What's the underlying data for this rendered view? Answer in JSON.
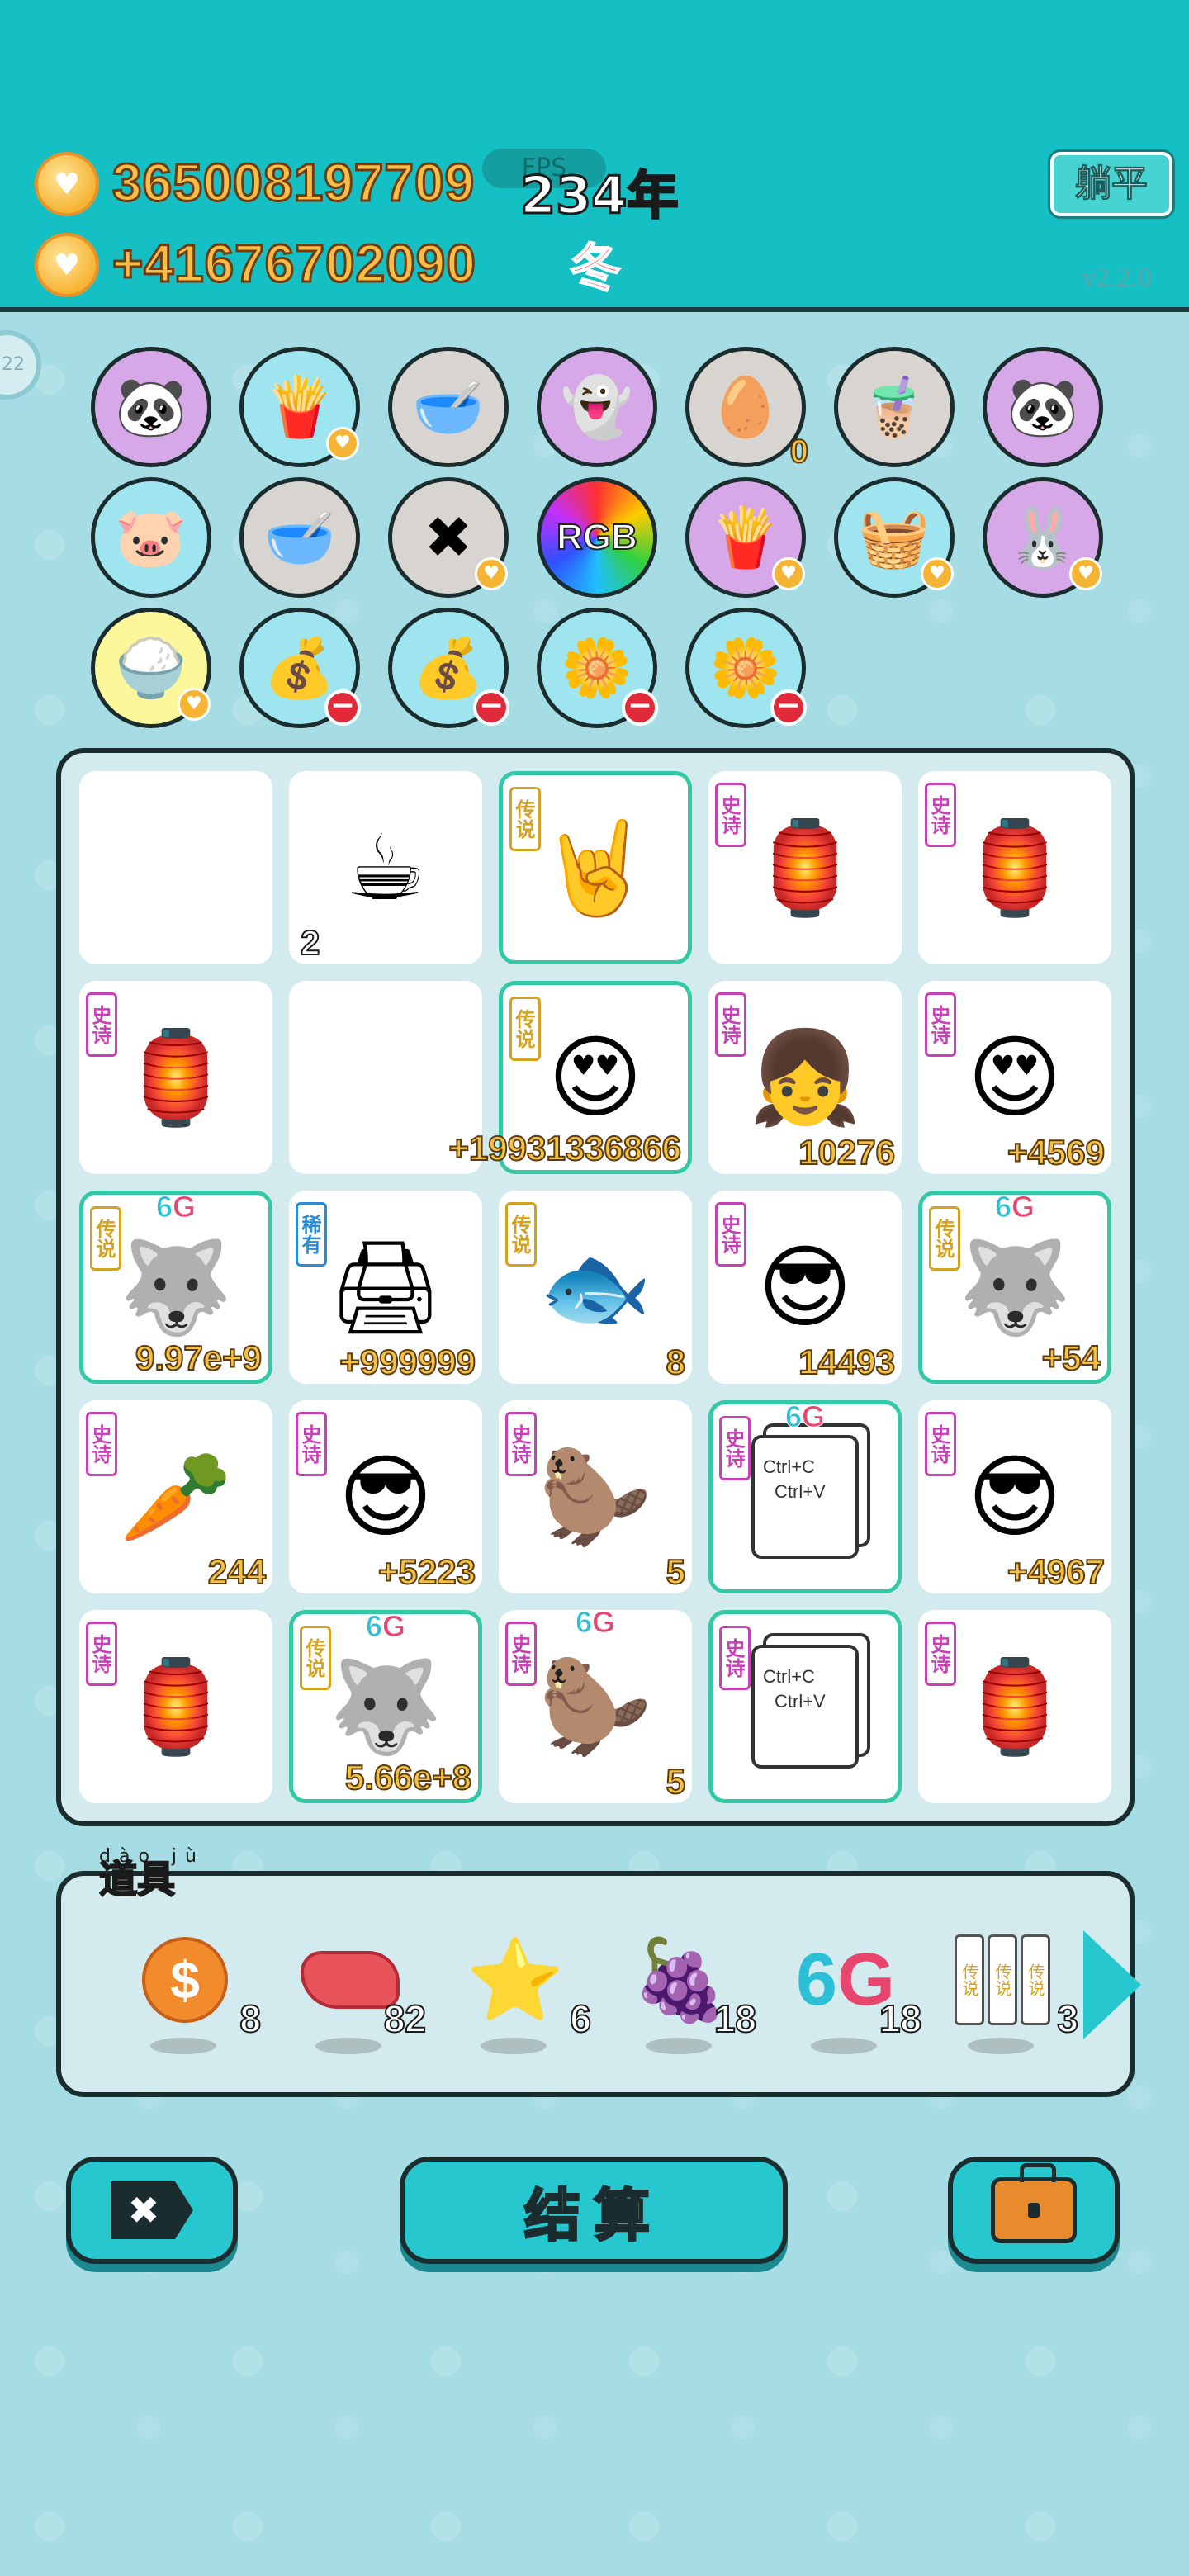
{
  "header": {
    "money": "365008197709",
    "income": "+41676702090",
    "fps_label": "FPS",
    "year": "234年",
    "season": "冬",
    "lieping_button": "躺平",
    "version": "v2.2.0",
    "side_bubble": "22"
  },
  "top_circles": [
    {
      "icon": "panda-icon",
      "glyph": "🐼",
      "color": "purple",
      "badge": ""
    },
    {
      "icon": "fries-icon",
      "glyph": "🍟",
      "color": "cyan",
      "badge": "heart"
    },
    {
      "icon": "pet-bowl-icon",
      "glyph": "🥣",
      "color": "grey",
      "badge": ""
    },
    {
      "icon": "ghost-icon",
      "glyph": "👻",
      "color": "purple",
      "badge": ""
    },
    {
      "icon": "egg-tray-icon",
      "glyph": "🥚",
      "color": "grey",
      "badge": "",
      "count": "0"
    },
    {
      "icon": "bubble-tea-icon",
      "glyph": "🧋",
      "color": "grey",
      "badge": ""
    },
    {
      "icon": "panda-icon",
      "glyph": "🐼",
      "color": "purple",
      "badge": ""
    },
    {
      "icon": "piggy-bank-icon",
      "glyph": "🐷",
      "color": "cyan",
      "badge": ""
    },
    {
      "icon": "pet-bowl-icon",
      "glyph": "🥣",
      "color": "grey",
      "badge": ""
    },
    {
      "icon": "delete-tag-icon",
      "glyph": "✖",
      "color": "grey",
      "badge": "heart"
    },
    {
      "icon": "rgb-icon",
      "glyph": "",
      "text": "RGB",
      "color": "rgb",
      "badge": ""
    },
    {
      "icon": "fries-icon",
      "glyph": "🍟",
      "color": "purple",
      "badge": "heart"
    },
    {
      "icon": "fruit-basket-icon",
      "glyph": "🧺",
      "color": "cyan",
      "badge": "heart"
    },
    {
      "icon": "rabbit-icon",
      "glyph": "🐰",
      "color": "purple",
      "badge": "heart"
    },
    {
      "icon": "rice-bowl-icon",
      "glyph": "🍚",
      "color": "yellow",
      "badge": "heart"
    },
    {
      "icon": "money-bag-icon",
      "glyph": "💰",
      "color": "cyan",
      "badge": "minus"
    },
    {
      "icon": "money-bag-icon",
      "glyph": "💰",
      "color": "cyan",
      "badge": "minus"
    },
    {
      "icon": "flower-pot-icon",
      "glyph": "🌼",
      "color": "cyan",
      "badge": "minus"
    },
    {
      "icon": "flower-pot-icon",
      "glyph": "🌼",
      "color": "cyan",
      "badge": "minus"
    }
  ],
  "board": [
    {
      "icon": "empty",
      "glyph": "",
      "tag": "",
      "count": "",
      "legend": false
    },
    {
      "icon": "coffee-cup-icon",
      "glyph": "☕",
      "tag": "",
      "count": "2",
      "count_style": "dark",
      "legend": false
    },
    {
      "icon": "rock-hand-icon",
      "glyph": "🤘",
      "tag": "传说",
      "tag_type": "leg",
      "count": "",
      "legend": true
    },
    {
      "icon": "rabbit-house-icon",
      "glyph": "🏮",
      "tag": "史诗",
      "tag_type": "epic",
      "count": "",
      "legend": false
    },
    {
      "icon": "rabbit-house-icon",
      "glyph": "🏮",
      "tag": "史诗",
      "tag_type": "epic",
      "count": "",
      "legend": false
    },
    {
      "icon": "rabbit-house-icon",
      "glyph": "🏮",
      "tag": "史诗",
      "tag_type": "epic",
      "count": "",
      "legend": false
    },
    {
      "icon": "empty",
      "glyph": "",
      "tag": "",
      "count": "",
      "legend": false
    },
    {
      "icon": "king-heart-eyes-icon",
      "glyph": "😍",
      "tag": "传说",
      "tag_type": "leg",
      "count": "+19931336866",
      "legend": true
    },
    {
      "icon": "girl-braids-icon",
      "glyph": "👧",
      "tag": "史诗",
      "tag_type": "epic",
      "count": "10276",
      "legend": false
    },
    {
      "icon": "heart-eyes-man-icon",
      "glyph": "😍",
      "tag": "史诗",
      "tag_type": "epic",
      "count": "+4569",
      "legend": false
    },
    {
      "icon": "husky-king-icon",
      "glyph": "🐺",
      "tag": "传说",
      "tag_type": "leg",
      "count": "9.97e+9",
      "legend": true,
      "sixg": true
    },
    {
      "icon": "printer-icon",
      "glyph": "🖨",
      "tag": "稀有",
      "tag_type": "rare",
      "count": "+999999",
      "legend": false
    },
    {
      "icon": "koi-fish-icon",
      "glyph": "🐟",
      "tag": "传说",
      "tag_type": "leg",
      "count": "8",
      "legend": false
    },
    {
      "icon": "sunglasses-man-icon",
      "glyph": "😎",
      "tag": "史诗",
      "tag_type": "epic",
      "count": "14493",
      "legend": false
    },
    {
      "icon": "husky-king-icon",
      "glyph": "🐺",
      "tag": "传说",
      "tag_type": "leg",
      "count": "+54",
      "legend": true,
      "sixg": true
    },
    {
      "icon": "carrot-icon",
      "glyph": "🥕",
      "tag": "史诗",
      "tag_type": "epic",
      "count": "244",
      "legend": false
    },
    {
      "icon": "sunglasses-man-icon",
      "glyph": "😎",
      "tag": "史诗",
      "tag_type": "epic",
      "count": "+5223",
      "legend": false
    },
    {
      "icon": "gopher-icon",
      "glyph": "🦫",
      "tag": "史诗",
      "tag_type": "epic",
      "count": "5",
      "legend": false
    },
    {
      "icon": "ctrl-cv-card-icon",
      "glyph": "",
      "ctrl": true,
      "tag": "史诗",
      "tag_type": "epic",
      "count": "",
      "legend": true,
      "sixg": true
    },
    {
      "icon": "sunglasses-man-icon",
      "glyph": "😎",
      "tag": "史诗",
      "tag_type": "epic",
      "count": "+4967",
      "legend": false
    },
    {
      "icon": "rabbit-house-icon",
      "glyph": "🏮",
      "tag": "史诗",
      "tag_type": "epic",
      "count": "",
      "legend": false
    },
    {
      "icon": "husky-king-icon",
      "glyph": "🐺",
      "tag": "传说",
      "tag_type": "leg",
      "count": "5.66e+8",
      "legend": true,
      "sixg": true
    },
    {
      "icon": "gopher-icon",
      "glyph": "🦫",
      "tag": "史诗",
      "tag_type": "epic",
      "count": "5",
      "legend": false,
      "sixg": true
    },
    {
      "icon": "ctrl-cv-card-icon",
      "glyph": "",
      "ctrl": true,
      "tag": "史诗",
      "tag_type": "epic",
      "count": "",
      "legend": true
    },
    {
      "icon": "rabbit-house-icon",
      "glyph": "🏮",
      "tag": "史诗",
      "tag_type": "epic",
      "count": "",
      "legend": false
    }
  ],
  "ctrl_card": {
    "line1": "Ctrl+C",
    "line2": "Ctrl+V"
  },
  "sixg_label": {
    "six": "6",
    "g": "G"
  },
  "items": {
    "label": "道具",
    "pinyin": "dào jù",
    "list": [
      {
        "icon": "dollar-coin-icon",
        "count": "8"
      },
      {
        "icon": "liver-icon",
        "count": "82"
      },
      {
        "icon": "star-icon",
        "count": "6"
      },
      {
        "icon": "bayberry-icon",
        "count": "18"
      },
      {
        "icon": "6g-icon",
        "count": "18"
      },
      {
        "icon": "legend-cards-icon",
        "count": "3"
      }
    ],
    "legend_card_text": "传说"
  },
  "buttons": {
    "delete_glyph": "✖",
    "settle_label": "结算"
  }
}
